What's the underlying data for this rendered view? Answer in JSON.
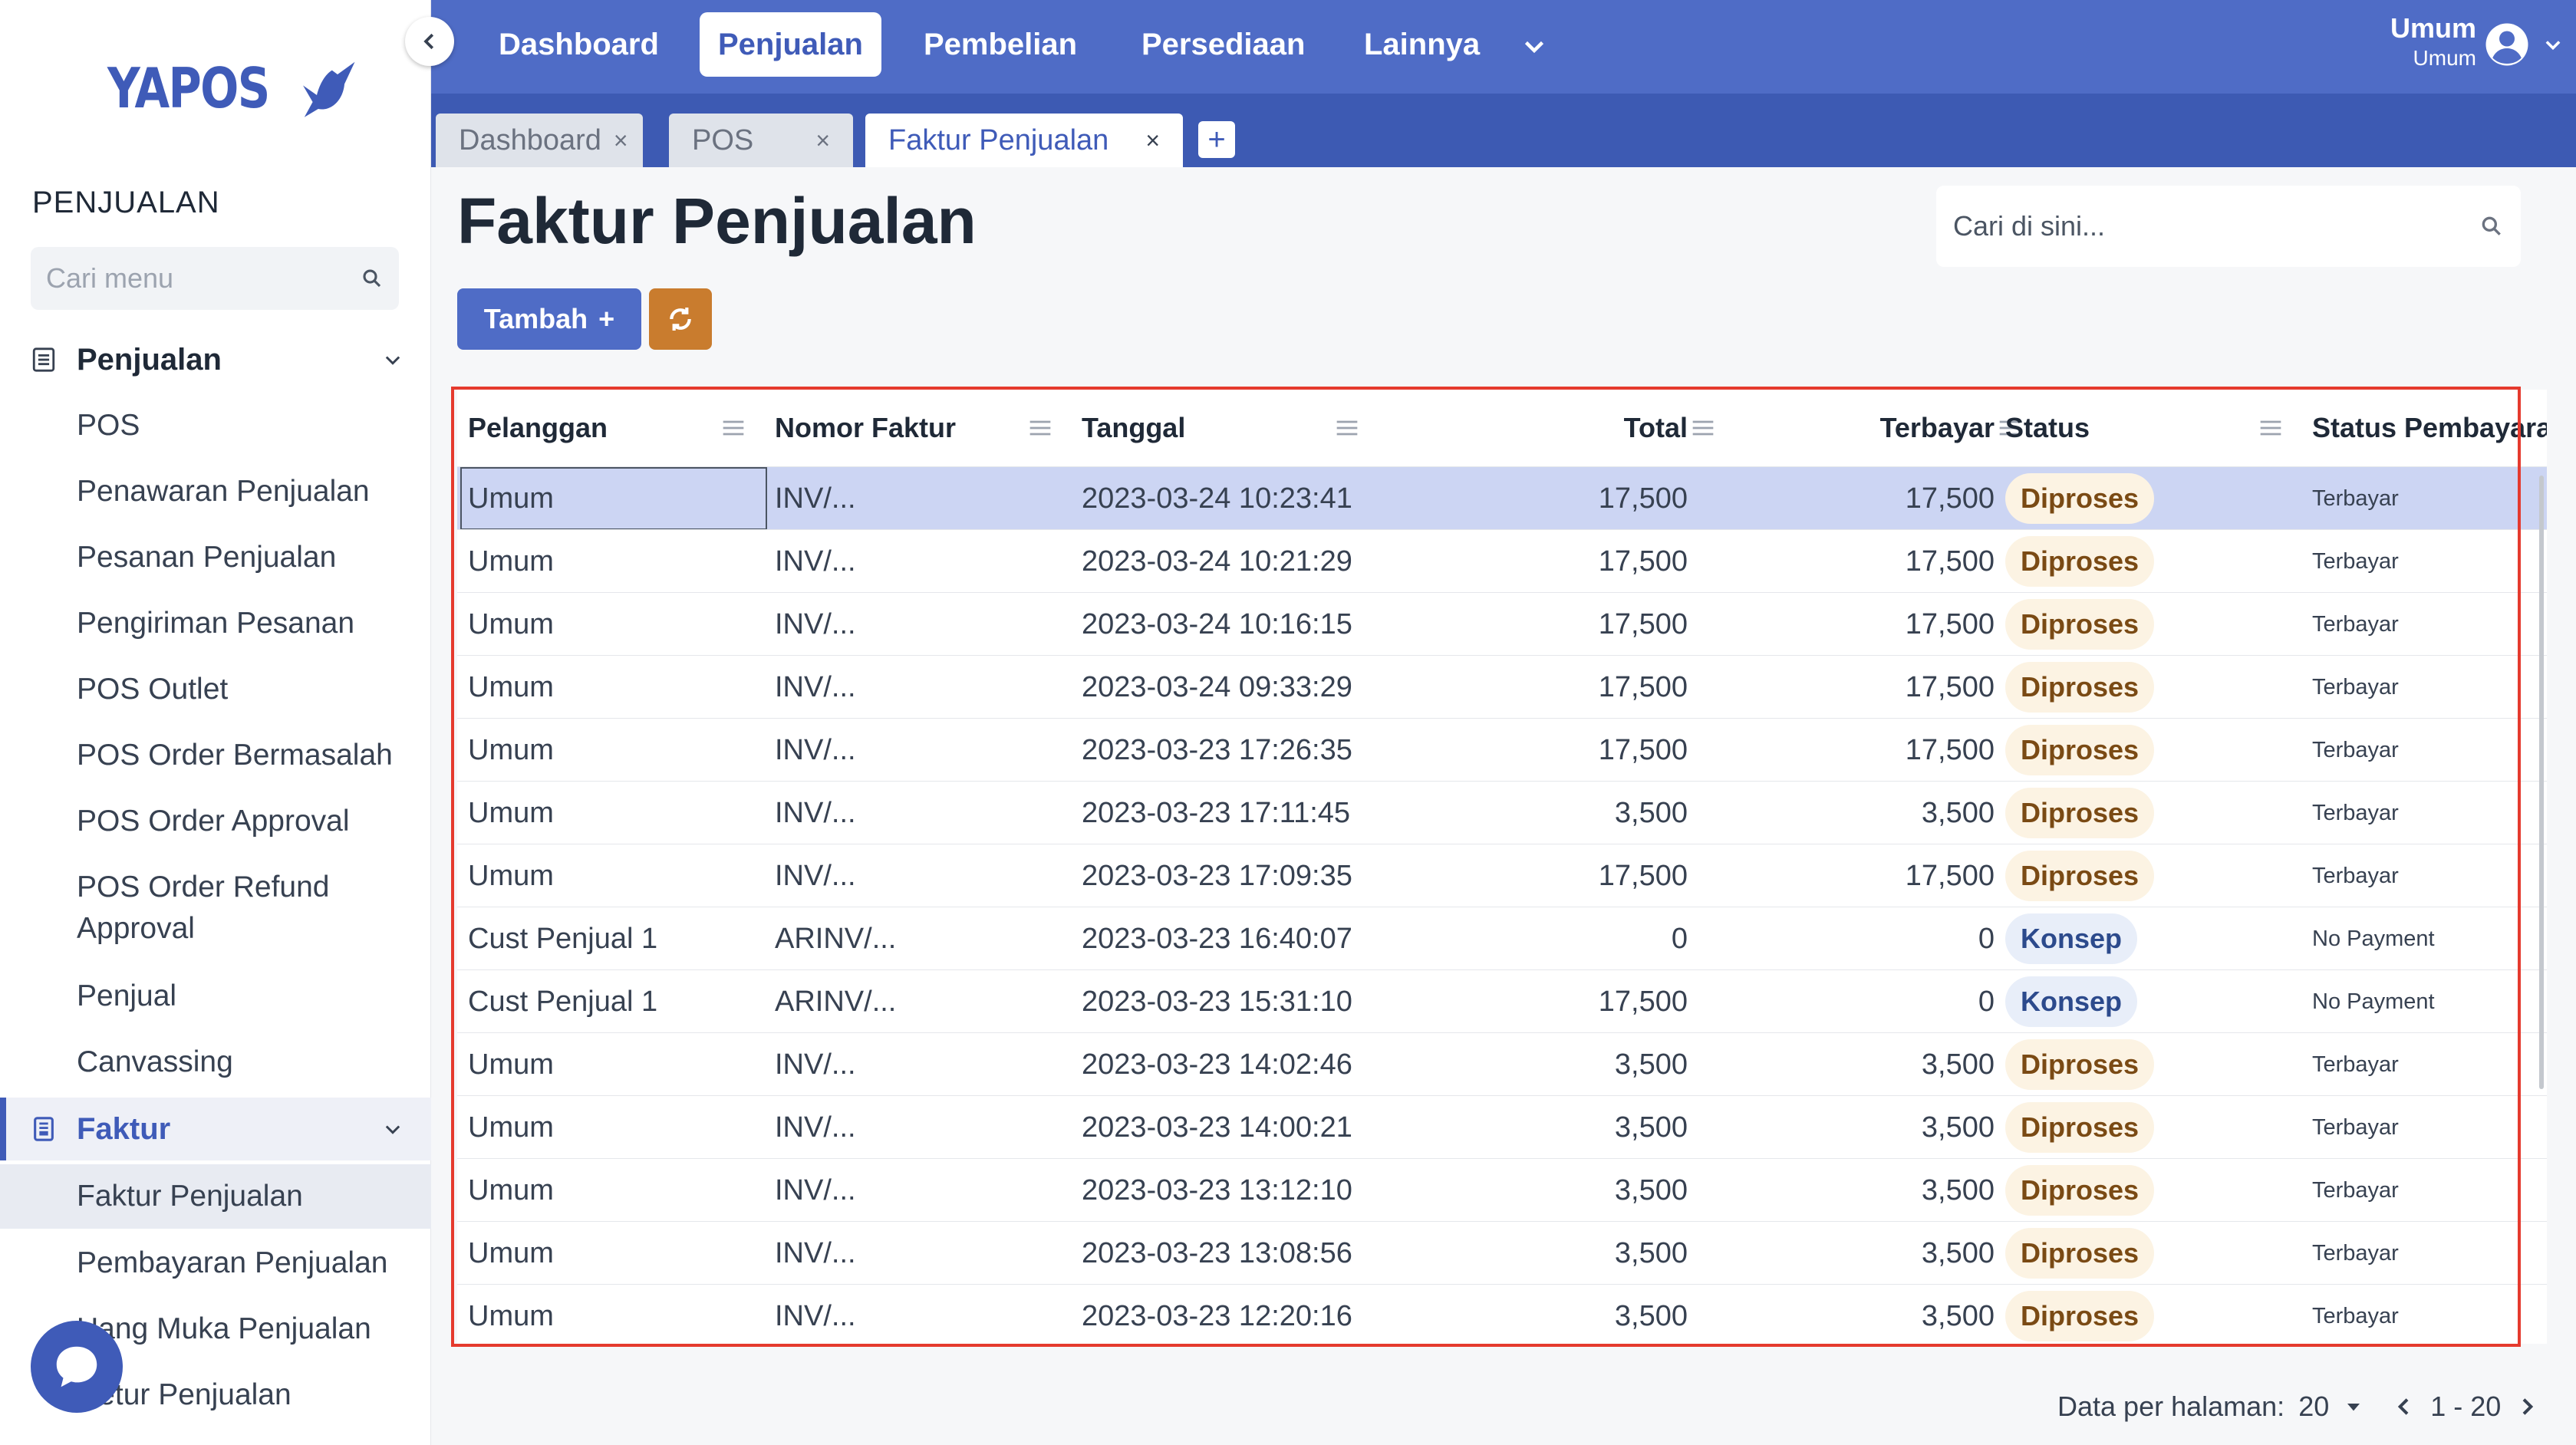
{
  "sidebar": {
    "logo_text": "YAPOS",
    "section_title": "PENJUALAN",
    "search_placeholder": "Cari menu",
    "groups": [
      {
        "label": "Penjualan",
        "items": [
          "POS",
          "Penawaran Penjualan",
          "Pesanan Penjualan",
          "Pengiriman Pesanan",
          "POS Outlet",
          "POS Order Bermasalah",
          "POS Order Approval",
          "POS Order Refund",
          "Approval",
          "Penjual",
          "Canvassing"
        ]
      },
      {
        "label": "Faktur",
        "items": [
          "Faktur Penjualan",
          "Pembayaran Penjualan",
          "Uang Muka Penjualan",
          "Retur Penjualan"
        ]
      }
    ]
  },
  "topbar": {
    "nav": [
      "Dashboard",
      "Penjualan",
      "Pembelian",
      "Persediaan",
      "Lainnya"
    ],
    "active_nav": "Penjualan",
    "user_name": "Umum",
    "user_role": "Umum"
  },
  "tabs": [
    {
      "label": "Dashboard",
      "close": "×"
    },
    {
      "label": "POS",
      "close": "×"
    },
    {
      "label": "Faktur Penjualan",
      "close": "×"
    }
  ],
  "tab_add": "+",
  "page": {
    "title": "Faktur Penjualan",
    "search_placeholder": "Cari di sini...",
    "add_button": "Tambah",
    "add_plus": "+"
  },
  "table": {
    "columns": [
      "Pelanggan",
      "Nomor Faktur",
      "Tanggal",
      "Total",
      "Terbayar",
      "Status",
      "Status Pembayara"
    ],
    "rows": [
      [
        "Umum",
        "INV/...",
        "2023-03-24 10:23:41",
        "17,500",
        "17,500",
        "Diproses",
        "Terbayar"
      ],
      [
        "Umum",
        "INV/...",
        "2023-03-24 10:21:29",
        "17,500",
        "17,500",
        "Diproses",
        "Terbayar"
      ],
      [
        "Umum",
        "INV/...",
        "2023-03-24 10:16:15",
        "17,500",
        "17,500",
        "Diproses",
        "Terbayar"
      ],
      [
        "Umum",
        "INV/...",
        "2023-03-24 09:33:29",
        "17,500",
        "17,500",
        "Diproses",
        "Terbayar"
      ],
      [
        "Umum",
        "INV/...",
        "2023-03-23 17:26:35",
        "17,500",
        "17,500",
        "Diproses",
        "Terbayar"
      ],
      [
        "Umum",
        "INV/...",
        "2023-03-23 17:11:45",
        "3,500",
        "3,500",
        "Diproses",
        "Terbayar"
      ],
      [
        "Umum",
        "INV/...",
        "2023-03-23 17:09:35",
        "17,500",
        "17,500",
        "Diproses",
        "Terbayar"
      ],
      [
        "Cust Penjual 1",
        "ARINV/...",
        "2023-03-23 16:40:07",
        "0",
        "0",
        "Konsep",
        "No Payment"
      ],
      [
        "Cust Penjual 1",
        "ARINV/...",
        "2023-03-23 15:31:10",
        "17,500",
        "0",
        "Konsep",
        "No Payment"
      ],
      [
        "Umum",
        "INV/...",
        "2023-03-23 14:02:46",
        "3,500",
        "3,500",
        "Diproses",
        "Terbayar"
      ],
      [
        "Umum",
        "INV/...",
        "2023-03-23 14:00:21",
        "3,500",
        "3,500",
        "Diproses",
        "Terbayar"
      ],
      [
        "Umum",
        "INV/...",
        "2023-03-23 13:12:10",
        "3,500",
        "3,500",
        "Diproses",
        "Terbayar"
      ],
      [
        "Umum",
        "INV/...",
        "2023-03-23 13:08:56",
        "3,500",
        "3,500",
        "Diproses",
        "Terbayar"
      ],
      [
        "Umum",
        "INV/...",
        "2023-03-23 12:20:16",
        "3,500",
        "3,500",
        "Diproses",
        "Terbayar"
      ]
    ]
  },
  "pager": {
    "label": "Data per halaman:",
    "per_page": "20",
    "range": "1 - 20"
  },
  "colors": {
    "brand": "#4f6cc6",
    "highlight_frame": "#e53a2e",
    "refresh_button": "#c97c2e"
  }
}
